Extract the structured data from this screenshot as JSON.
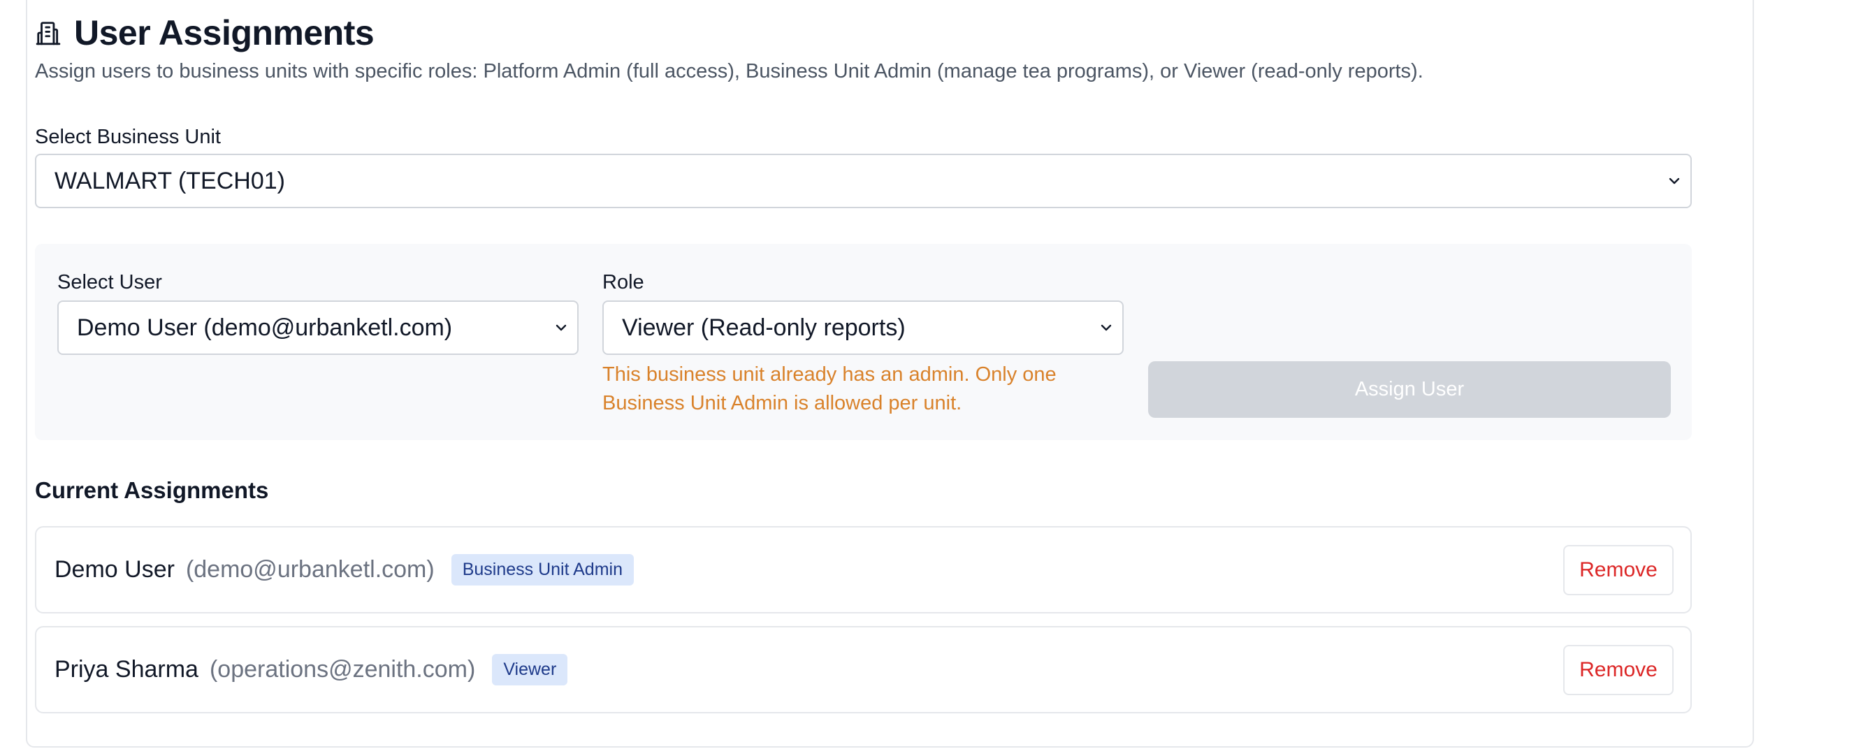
{
  "header": {
    "icon": "building-icon",
    "title": "User Assignments",
    "subtitle": "Assign users to business units with specific roles: Platform Admin (full access), Business Unit Admin (manage tea programs), or Viewer (read-only reports)."
  },
  "business_unit": {
    "label": "Select Business Unit",
    "selected": "WALMART (TECH01)"
  },
  "assign_form": {
    "user_label": "Select User",
    "user_selected": "Demo User (demo@urbanketl.com)",
    "role_label": "Role",
    "role_selected": "Viewer (Read-only reports)",
    "warning": "This business unit already has an admin. Only one Business Unit Admin is allowed per unit.",
    "assign_button": "Assign User"
  },
  "current_assignments": {
    "heading": "Current Assignments",
    "rows": [
      {
        "name": "Demo User",
        "email": "(demo@urbanketl.com)",
        "role": "Business Unit Admin",
        "action": "Remove"
      },
      {
        "name": "Priya Sharma",
        "email": "(operations@zenith.com)",
        "role": "Viewer",
        "action": "Remove"
      }
    ]
  },
  "colors": {
    "warning": "#d9822b",
    "remove": "#dc2626",
    "badge_bg": "#dbe7fb",
    "badge_text": "#1e3a8a",
    "disabled_button": "#d1d5db"
  }
}
